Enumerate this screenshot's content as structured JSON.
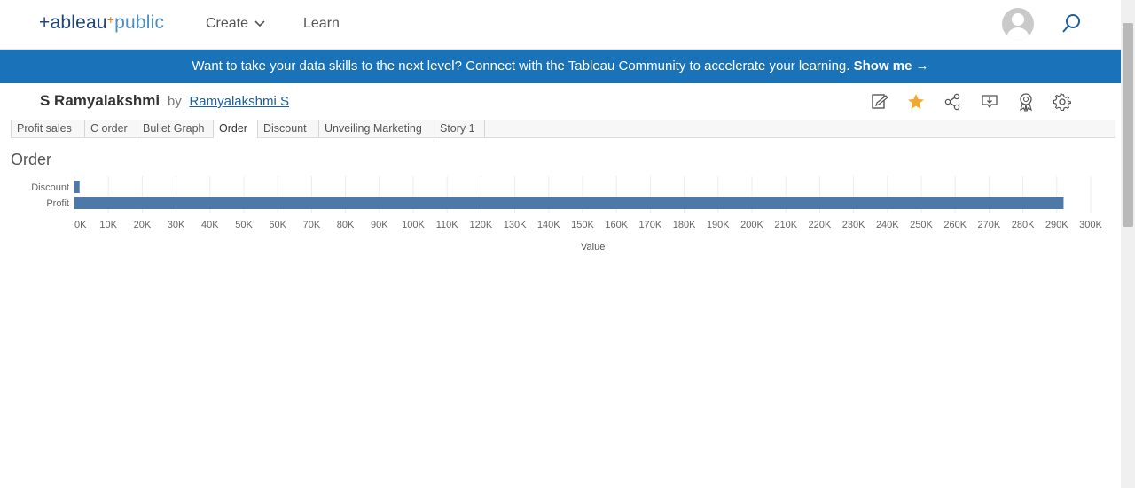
{
  "header": {
    "logo": {
      "left": "+ableau",
      "mid": "+",
      "right": "public"
    },
    "nav": [
      {
        "label": "Create"
      },
      {
        "label": "Learn"
      }
    ]
  },
  "banner": {
    "text": "Want to take your data skills to the next level? Connect with the Tableau Community to accelerate your learning.",
    "cta": "Show me →"
  },
  "viz": {
    "title": "S Ramyalakshmi",
    "by": "by",
    "author": "Ramyalakshmi S",
    "toolbar_icons": [
      "edit-icon",
      "favorite-star-icon",
      "share-icon",
      "download-icon",
      "award-icon",
      "settings-icon"
    ],
    "accent_star": "#f0a830"
  },
  "tabs": [
    {
      "label": "Profit sales"
    },
    {
      "label": "C order"
    },
    {
      "label": "Bullet Graph"
    },
    {
      "label": "Order",
      "active": true
    },
    {
      "label": "Discount"
    },
    {
      "label": "Unveiling Marketing"
    },
    {
      "label": "Story 1"
    }
  ],
  "chart_data": {
    "type": "bar",
    "orientation": "horizontal",
    "title": "Order",
    "categories": [
      "Discount",
      "Profit"
    ],
    "values": [
      1500,
      292000
    ],
    "xlabel": "Value",
    "xlim": [
      0,
      300000
    ],
    "ticks": [
      "0K",
      "10K",
      "20K",
      "30K",
      "40K",
      "50K",
      "60K",
      "70K",
      "80K",
      "90K",
      "100K",
      "110K",
      "120K",
      "130K",
      "140K",
      "150K",
      "160K",
      "170K",
      "180K",
      "190K",
      "200K",
      "210K",
      "220K",
      "230K",
      "240K",
      "250K",
      "260K",
      "270K",
      "280K",
      "290K",
      "300K"
    ],
    "grid": true,
    "color": "#4e79a7"
  }
}
